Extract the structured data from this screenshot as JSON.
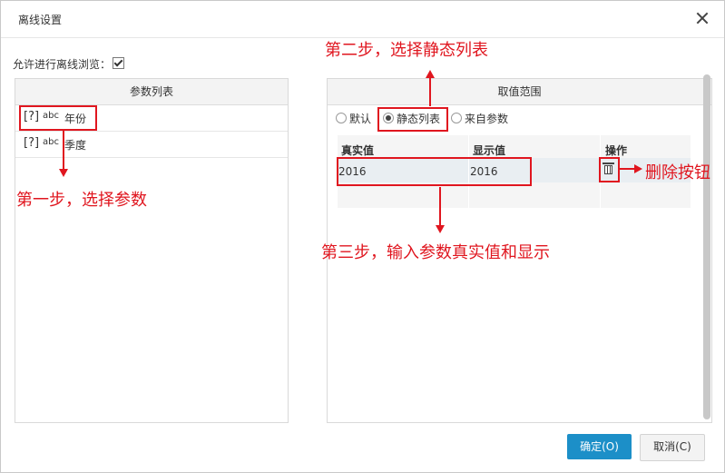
{
  "dialog": {
    "title": "离线设置"
  },
  "allow_offline": {
    "label": "允许进行离线浏览：",
    "checked": true
  },
  "left_panel": {
    "header": "参数列表",
    "params": [
      {
        "type_icon": "[?]",
        "type": "abc",
        "name": "年份"
      },
      {
        "type_icon": "[?]",
        "type": "abc",
        "name": "季度"
      }
    ]
  },
  "right_panel": {
    "header": "取值范围",
    "radios": [
      {
        "label": "默认",
        "selected": false
      },
      {
        "label": "静态列表",
        "selected": true
      },
      {
        "label": "来自参数",
        "selected": false
      }
    ],
    "table": {
      "columns": [
        "真实值",
        "显示值",
        "操作"
      ],
      "rows": [
        {
          "real": "2016",
          "display": "2016"
        }
      ]
    }
  },
  "annotations": {
    "step1": "第一步，选择参数",
    "step2": "第二步，选择静态列表",
    "step3": "第三步，输入参数真实值和显示",
    "delete": "删除按钮",
    "color": "#e0161f"
  },
  "buttons": {
    "ok": "确定(O)",
    "cancel": "取消(C)"
  },
  "colors": {
    "primary": "#1c8fc8"
  }
}
